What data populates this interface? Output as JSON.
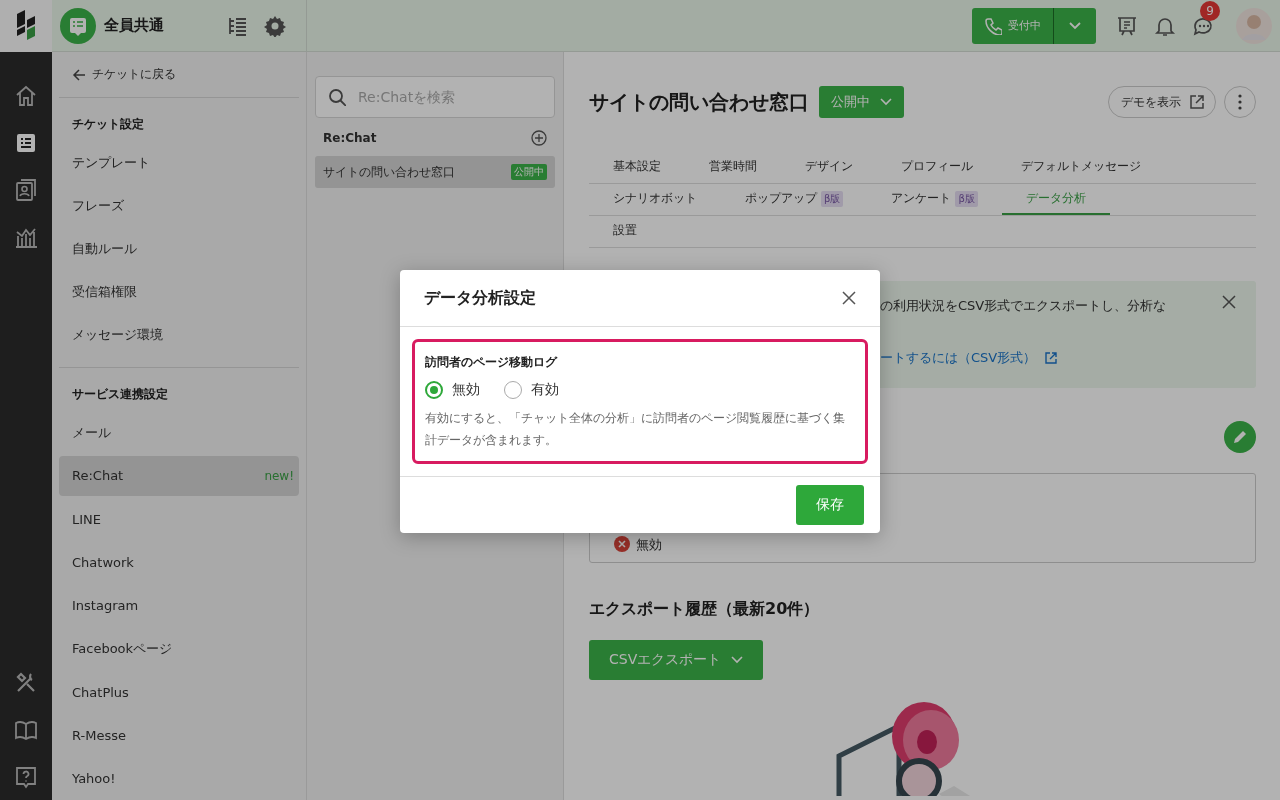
{
  "app": {
    "workspace": "全員共通",
    "status_button": "受付中",
    "notification_count": "9"
  },
  "rail": [
    {
      "kind": "home",
      "selected": false
    },
    {
      "kind": "ticket",
      "selected": true
    },
    {
      "kind": "contacts",
      "selected": false
    },
    {
      "kind": "analytics",
      "selected": false
    },
    {
      "kind": "tools",
      "selected": false
    },
    {
      "kind": "book",
      "selected": false
    },
    {
      "kind": "help",
      "selected": false
    }
  ],
  "sidebar": {
    "back": "チケットに戻る",
    "sections": [
      {
        "title": "チケット設定",
        "items": [
          {
            "label": "テンプレート",
            "selected": false
          },
          {
            "label": "フレーズ",
            "selected": false
          },
          {
            "label": "自動ルール",
            "selected": false
          },
          {
            "label": "受信箱権限",
            "selected": false
          },
          {
            "label": "メッセージ環境",
            "selected": false
          }
        ]
      },
      {
        "title": "サービス連携設定",
        "items": [
          {
            "label": "メール",
            "selected": false
          },
          {
            "label": "Re:Chat",
            "selected": true,
            "badge": "new!"
          },
          {
            "label": "LINE",
            "selected": false
          },
          {
            "label": "Chatwork",
            "selected": false
          },
          {
            "label": "Instagram",
            "selected": false
          },
          {
            "label": "Facebookページ",
            "selected": false
          },
          {
            "label": "ChatPlus",
            "selected": false
          },
          {
            "label": "R-Messe",
            "selected": false
          },
          {
            "label": "Yahoo!",
            "selected": false
          }
        ]
      }
    ]
  },
  "channel_list": {
    "search": {
      "placeholder": "Re:Chatを検索"
    },
    "heading": "Re:Chat",
    "items": [
      {
        "label": "サイトの問い合わせ窓口",
        "status": "公開中",
        "selected": true
      }
    ]
  },
  "page": {
    "title": "サイトの問い合わせ窓口",
    "status": "公開中",
    "demo_button": "デモを表示",
    "tab_rows": [
      {
        "tabs": [
          {
            "label": "基本設定",
            "selected": false
          },
          {
            "label": "営業時間",
            "selected": false
          },
          {
            "label": "デザイン",
            "selected": false
          },
          {
            "label": "プロフィール",
            "selected": false
          },
          {
            "label": "デフォルトメッセージ",
            "selected": false
          }
        ]
      },
      {
        "tabs": [
          {
            "label": "シナリオボット",
            "selected": false
          },
          {
            "label": "ポップアップ",
            "badge": "β版",
            "selected": false
          },
          {
            "label": "アンケート",
            "badge": "β版",
            "selected": false
          },
          {
            "label": "データ分析",
            "selected": true
          }
        ]
      },
      {
        "tabs": [
          {
            "label": "設置",
            "selected": false
          }
        ]
      }
    ],
    "banner": {
      "text": "の利用状況をCSV形式でエクスポートし、分析な",
      "link": "ートするには（CSV形式）"
    },
    "setting_value": "無効",
    "export": {
      "heading": "エクスポート履歴（最新20件）",
      "button": "CSVエクスポート"
    }
  },
  "dialog": {
    "title": "データ分析設定",
    "field_label": "訪問者のページ移動ログ",
    "options": [
      {
        "label": "無効",
        "selected": true
      },
      {
        "label": "有効",
        "selected": false
      }
    ],
    "help": "有効にすると、「チャット全体の分析」に訪問者のページ閲覧履歴に基づく集計データが含まれます。",
    "save": "保存"
  }
}
